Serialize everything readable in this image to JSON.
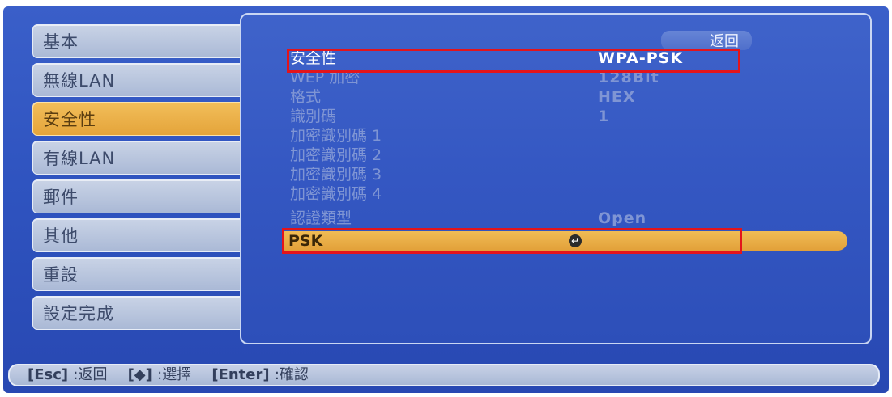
{
  "sidebar": {
    "items": [
      {
        "label": "基本",
        "active": false
      },
      {
        "label": "無線LAN",
        "active": false
      },
      {
        "label": "安全性",
        "active": true
      },
      {
        "label": "有線LAN",
        "active": false
      },
      {
        "label": "郵件",
        "active": false
      },
      {
        "label": "其他",
        "active": false
      },
      {
        "label": "重設",
        "active": false
      },
      {
        "label": "設定完成",
        "active": false
      }
    ]
  },
  "panel": {
    "back_label": "返回",
    "rows": [
      {
        "label": "安全性",
        "value": "WPA-PSK",
        "enabled": true
      },
      {
        "label": "WEP 加密",
        "value": "128Bit",
        "enabled": false
      },
      {
        "label": "格式",
        "value": "HEX",
        "enabled": false
      },
      {
        "label": "識別碼",
        "value": "1",
        "enabled": false
      },
      {
        "label": "加密識別碼 1",
        "value": "",
        "enabled": false
      },
      {
        "label": "加密識別碼 2",
        "value": "",
        "enabled": false
      },
      {
        "label": "加密識別碼 3",
        "value": "",
        "enabled": false
      },
      {
        "label": "加密識別碼 4",
        "value": "",
        "enabled": false
      },
      {
        "label": "認證類型",
        "value": "Open",
        "enabled": false
      }
    ],
    "psk": {
      "label": "PSK",
      "icon": "enter-icon"
    }
  },
  "hint": {
    "esc_key": "[Esc]",
    "esc_action": ":返回",
    "arrow_key": "[◆]",
    "arrow_action": ":選擇",
    "enter_key": "[Enter]",
    "enter_action": ":確認"
  },
  "colors": {
    "background": "#2f54c0",
    "highlight": "#e4a43a",
    "annotation_box": "#e3141b"
  }
}
